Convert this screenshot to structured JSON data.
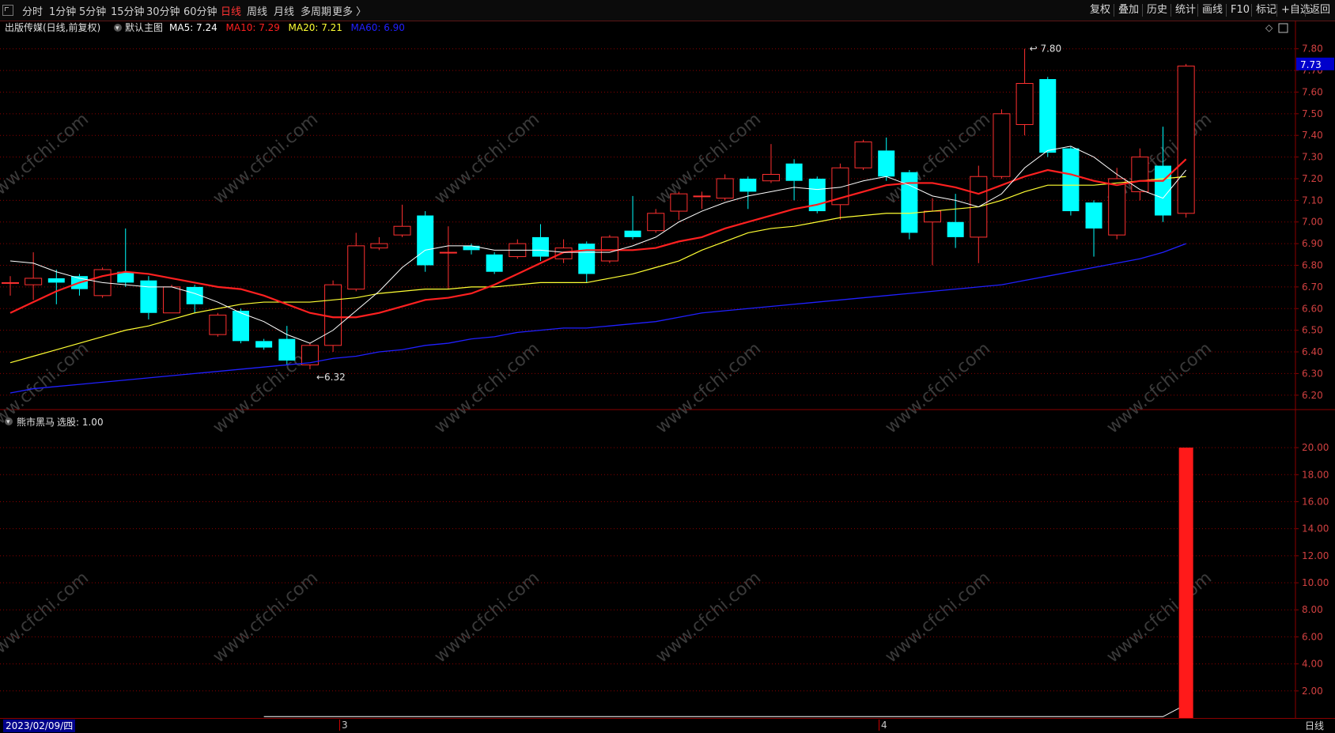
{
  "toolbar": {
    "corner_icon": "collapse-corner-icon",
    "periods": [
      "分时",
      "1分钟",
      "5分钟",
      "15分钟",
      "30分钟",
      "60分钟",
      "日线",
      "周线",
      "月线",
      "多周期",
      "更多 〉"
    ],
    "active_period": "日线",
    "right_buttons": [
      "复权",
      "叠加",
      "历史",
      "统计",
      "画线",
      "F10",
      "+自选",
      "返回"
    ],
    "marker_label": "标记"
  },
  "main_panel": {
    "stock_name": "出版传媒(日线,前复权)",
    "template": "默认主图",
    "ma": [
      {
        "label": "MA5:",
        "value": "7.24",
        "color": "#ffffff"
      },
      {
        "label": "MA10:",
        "value": "7.29",
        "color": "#ff2020"
      },
      {
        "label": "MA20:",
        "value": "7.21",
        "color": "#ffff33"
      },
      {
        "label": "MA60:",
        "value": "6.90",
        "color": "#2020ff"
      }
    ],
    "current_price": "7.73",
    "high_marker": "7.80",
    "low_marker": "6.32",
    "y_ticks": [
      "7.80",
      "7.70",
      "7.60",
      "7.50",
      "7.40",
      "7.30",
      "7.20",
      "7.10",
      "7.00",
      "6.90",
      "6.80",
      "6.70",
      "6.60",
      "6.50",
      "6.40",
      "6.30",
      "6.20"
    ]
  },
  "sub_panel": {
    "indicator_name": "熊市黑马",
    "pick_label": "选股:",
    "pick_value": "1.00",
    "y_ticks": [
      "20.00",
      "18.00",
      "16.00",
      "14.00",
      "12.00",
      "10.00",
      "8.00",
      "6.00",
      "4.00",
      "2.00"
    ]
  },
  "status_bar": {
    "date": "2023/02/09/四",
    "month_marks": [
      "3",
      "4"
    ],
    "period": "日线"
  },
  "watermark": "www.cfchi.com",
  "colors": {
    "up": "#ff3030",
    "down": "#00ffff",
    "grid": "#8b0000",
    "ma5": "#ffffff",
    "ma10": "#ff2020",
    "ma20": "#ffff33",
    "ma60": "#2020ff"
  },
  "chart_data": {
    "type": "candlestick",
    "candles": [
      {
        "o": 6.72,
        "c": 6.72,
        "h": 6.75,
        "l": 6.66
      },
      {
        "o": 6.71,
        "c": 6.74,
        "h": 6.86,
        "l": 6.64
      },
      {
        "o": 6.74,
        "c": 6.72,
        "h": 6.78,
        "l": 6.62
      },
      {
        "o": 6.75,
        "c": 6.69,
        "h": 6.76,
        "l": 6.66
      },
      {
        "o": 6.66,
        "c": 6.78,
        "h": 6.79,
        "l": 6.65
      },
      {
        "o": 6.77,
        "c": 6.72,
        "h": 6.97,
        "l": 6.7
      },
      {
        "o": 6.73,
        "c": 6.58,
        "h": 6.75,
        "l": 6.55
      },
      {
        "o": 6.58,
        "c": 6.7,
        "h": 6.71,
        "l": 6.58
      },
      {
        "o": 6.7,
        "c": 6.62,
        "h": 6.71,
        "l": 6.58
      },
      {
        "o": 6.48,
        "c": 6.57,
        "h": 6.58,
        "l": 6.47
      },
      {
        "o": 6.59,
        "c": 6.45,
        "h": 6.6,
        "l": 6.44
      },
      {
        "o": 6.45,
        "c": 6.42,
        "h": 6.46,
        "l": 6.41
      },
      {
        "o": 6.46,
        "c": 6.36,
        "h": 6.52,
        "l": 6.34
      },
      {
        "o": 6.34,
        "c": 6.43,
        "h": 6.44,
        "l": 6.32
      },
      {
        "o": 6.43,
        "c": 6.71,
        "h": 6.73,
        "l": 6.4
      },
      {
        "o": 6.69,
        "c": 6.89,
        "h": 6.95,
        "l": 6.68
      },
      {
        "o": 6.88,
        "c": 6.9,
        "h": 6.93,
        "l": 6.87
      },
      {
        "o": 6.94,
        "c": 6.98,
        "h": 7.08,
        "l": 6.93
      },
      {
        "o": 7.03,
        "c": 6.8,
        "h": 7.05,
        "l": 6.77
      },
      {
        "o": 6.86,
        "c": 6.86,
        "h": 6.98,
        "l": 6.69
      },
      {
        "o": 6.89,
        "c": 6.87,
        "h": 6.9,
        "l": 6.85
      },
      {
        "o": 6.85,
        "c": 6.77,
        "h": 6.86,
        "l": 6.76
      },
      {
        "o": 6.84,
        "c": 6.9,
        "h": 6.92,
        "l": 6.83
      },
      {
        "o": 6.93,
        "c": 6.84,
        "h": 6.99,
        "l": 6.82
      },
      {
        "o": 6.83,
        "c": 6.88,
        "h": 6.92,
        "l": 6.81
      },
      {
        "o": 6.9,
        "c": 6.76,
        "h": 6.91,
        "l": 6.72
      },
      {
        "o": 6.82,
        "c": 6.93,
        "h": 6.94,
        "l": 6.81
      },
      {
        "o": 6.96,
        "c": 6.93,
        "h": 7.12,
        "l": 6.92
      },
      {
        "o": 6.96,
        "c": 7.04,
        "h": 7.06,
        "l": 6.95
      },
      {
        "o": 7.05,
        "c": 7.13,
        "h": 7.14,
        "l": 7.01
      },
      {
        "o": 7.12,
        "c": 7.12,
        "h": 7.14,
        "l": 7.06
      },
      {
        "o": 7.11,
        "c": 7.2,
        "h": 7.22,
        "l": 7.1
      },
      {
        "o": 7.2,
        "c": 7.14,
        "h": 7.21,
        "l": 7.06
      },
      {
        "o": 7.19,
        "c": 7.22,
        "h": 7.36,
        "l": 7.18
      },
      {
        "o": 7.27,
        "c": 7.19,
        "h": 7.29,
        "l": 7.1
      },
      {
        "o": 7.2,
        "c": 7.05,
        "h": 7.21,
        "l": 7.04
      },
      {
        "o": 7.08,
        "c": 7.25,
        "h": 7.27,
        "l": 7.01
      },
      {
        "o": 7.25,
        "c": 7.37,
        "h": 7.38,
        "l": 7.24
      },
      {
        "o": 7.33,
        "c": 7.21,
        "h": 7.39,
        "l": 7.19
      },
      {
        "o": 7.23,
        "c": 6.95,
        "h": 7.24,
        "l": 6.92
      },
      {
        "o": 7.0,
        "c": 7.05,
        "h": 7.11,
        "l": 6.8
      },
      {
        "o": 7.0,
        "c": 6.93,
        "h": 7.13,
        "l": 6.88
      },
      {
        "o": 6.93,
        "c": 7.21,
        "h": 7.26,
        "l": 6.81
      },
      {
        "o": 7.21,
        "c": 7.5,
        "h": 7.52,
        "l": 7.2
      },
      {
        "o": 7.45,
        "c": 7.64,
        "h": 7.8,
        "l": 7.4
      },
      {
        "o": 7.66,
        "c": 7.32,
        "h": 7.67,
        "l": 7.3
      },
      {
        "o": 7.34,
        "c": 7.05,
        "h": 7.35,
        "l": 7.03
      },
      {
        "o": 7.09,
        "c": 6.97,
        "h": 7.1,
        "l": 6.84
      },
      {
        "o": 6.94,
        "c": 7.2,
        "h": 7.25,
        "l": 6.92
      },
      {
        "o": 7.14,
        "c": 7.3,
        "h": 7.34,
        "l": 7.1
      },
      {
        "o": 7.26,
        "c": 7.03,
        "h": 7.44,
        "l": 7.0
      },
      {
        "o": 7.04,
        "c": 7.72,
        "h": 7.73,
        "l": 7.02
      }
    ],
    "ma5": [
      6.82,
      6.81,
      6.77,
      6.74,
      6.72,
      6.71,
      6.7,
      6.7,
      6.67,
      6.63,
      6.58,
      6.54,
      6.48,
      6.44,
      6.5,
      6.59,
      6.68,
      6.79,
      6.87,
      6.89,
      6.89,
      6.87,
      6.87,
      6.87,
      6.86,
      6.86,
      6.86,
      6.89,
      6.93,
      7.0,
      7.05,
      7.09,
      7.12,
      7.14,
      7.16,
      7.15,
      7.16,
      7.19,
      7.21,
      7.17,
      7.12,
      7.1,
      7.07,
      7.13,
      7.25,
      7.33,
      7.35,
      7.3,
      7.22,
      7.15,
      7.11,
      7.24
    ],
    "ma10": [
      6.58,
      6.63,
      6.68,
      6.72,
      6.75,
      6.77,
      6.76,
      6.74,
      6.72,
      6.7,
      6.69,
      6.66,
      6.62,
      6.58,
      6.56,
      6.56,
      6.58,
      6.61,
      6.64,
      6.65,
      6.67,
      6.71,
      6.76,
      6.81,
      6.86,
      6.87,
      6.87,
      6.87,
      6.88,
      6.91,
      6.93,
      6.97,
      7.0,
      7.03,
      7.06,
      7.08,
      7.11,
      7.14,
      7.17,
      7.18,
      7.18,
      7.16,
      7.13,
      7.17,
      7.21,
      7.24,
      7.22,
      7.19,
      7.17,
      7.19,
      7.19,
      7.29
    ],
    "ma20": [
      6.35,
      6.38,
      6.41,
      6.44,
      6.47,
      6.5,
      6.52,
      6.55,
      6.58,
      6.6,
      6.62,
      6.63,
      6.63,
      6.63,
      6.64,
      6.65,
      6.67,
      6.68,
      6.69,
      6.69,
      6.7,
      6.7,
      6.71,
      6.72,
      6.72,
      6.72,
      6.74,
      6.76,
      6.79,
      6.82,
      6.87,
      6.91,
      6.95,
      6.97,
      6.98,
      7.0,
      7.02,
      7.03,
      7.04,
      7.04,
      7.05,
      7.06,
      7.07,
      7.1,
      7.14,
      7.17,
      7.17,
      7.17,
      7.18,
      7.19,
      7.2,
      7.21
    ],
    "ma60": [
      6.21,
      6.23,
      6.24,
      6.25,
      6.26,
      6.27,
      6.28,
      6.29,
      6.3,
      6.31,
      6.32,
      6.33,
      6.34,
      6.35,
      6.37,
      6.38,
      6.4,
      6.41,
      6.43,
      6.44,
      6.46,
      6.47,
      6.49,
      6.5,
      6.51,
      6.51,
      6.52,
      6.53,
      6.54,
      6.56,
      6.58,
      6.59,
      6.6,
      6.61,
      6.62,
      6.63,
      6.64,
      6.65,
      6.66,
      6.67,
      6.68,
      6.69,
      6.7,
      6.71,
      6.73,
      6.75,
      6.77,
      6.79,
      6.81,
      6.83,
      6.86,
      6.9
    ],
    "main_ylim": [
      6.17,
      7.85
    ],
    "indicator": {
      "name": "熊市黑马",
      "signal_bar_index": 51,
      "signal_value": 20.0,
      "line_start_index": 11,
      "line_end_value": 1.0,
      "ylim": [
        0,
        21
      ]
    }
  }
}
